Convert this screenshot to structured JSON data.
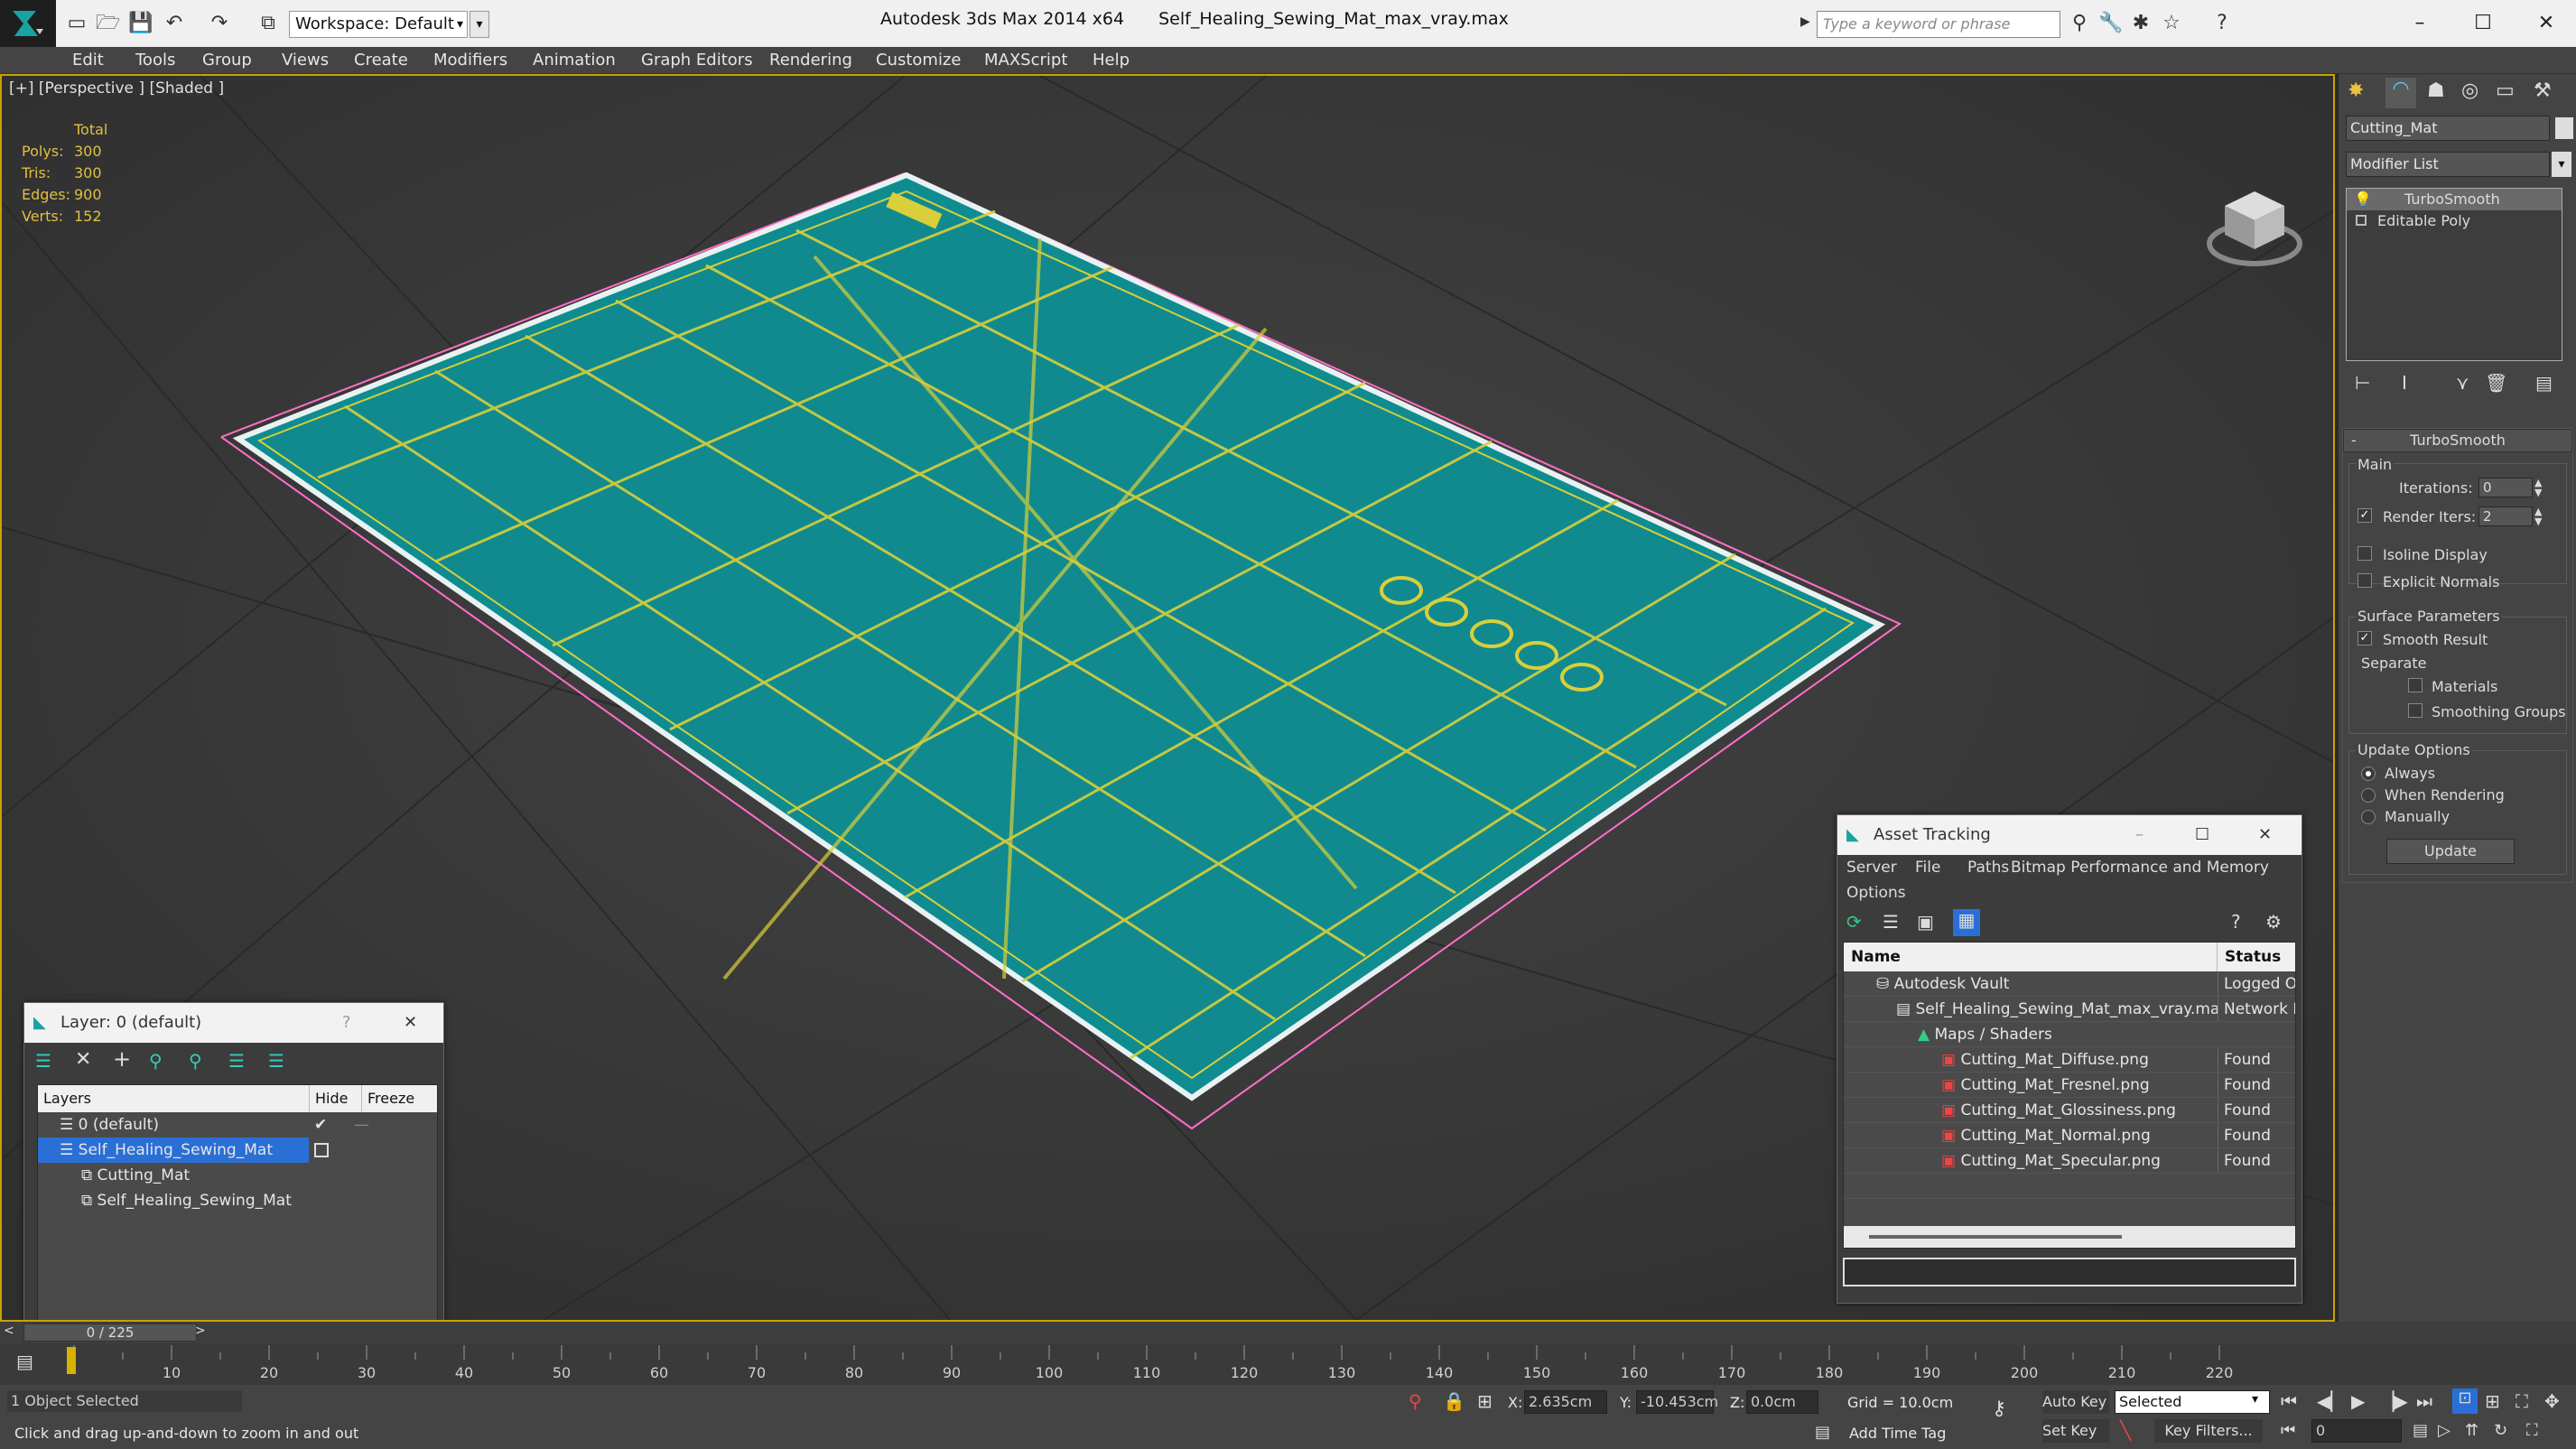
{
  "titlebar": {
    "workspace": "Workspace: Default",
    "app_name": "Autodesk 3ds Max  2014 x64",
    "file_name": "Self_Healing_Sewing_Mat_max_vray.max",
    "search_placeholder": "Type a keyword or phrase"
  },
  "menu": [
    "Edit",
    "Tools",
    "Group",
    "Views",
    "Create",
    "Modifiers",
    "Animation",
    "Graph Editors",
    "Rendering",
    "Customize",
    "MAXScript",
    "Help"
  ],
  "viewport": {
    "label": "[+] [Perspective ] [Shaded ]",
    "stats": {
      "header": "Total",
      "rows": [
        {
          "label": "Polys:",
          "value": "300"
        },
        {
          "label": "Tris:",
          "value": "300"
        },
        {
          "label": "Edges:",
          "value": "900"
        },
        {
          "label": "Verts:",
          "value": "152"
        }
      ]
    },
    "colors": {
      "mat": "#0e8f92",
      "grid": "#d8cf3a",
      "selection": "#ff6fc8",
      "background": "#3a3a3a"
    }
  },
  "command_panel": {
    "object_name": "Cutting_Mat",
    "modifier_list": "Modifier List",
    "stack": [
      "TurboSmooth",
      "Editable Poly"
    ],
    "turbosmooth": {
      "title": "TurboSmooth",
      "main": "Main",
      "iterations_label": "Iterations:",
      "iterations": "0",
      "render_iters_label": "Render Iters:",
      "render_iters": "2",
      "isoline": "Isoline Display",
      "explicit_normals": "Explicit Normals",
      "surface_params": "Surface Parameters",
      "smooth_result": "Smooth Result",
      "separate": "Separate",
      "materials": "Materials",
      "smoothing_groups": "Smoothing Groups",
      "update_options": "Update Options",
      "always": "Always",
      "when_rendering": "When Rendering",
      "manually": "Manually",
      "update_button": "Update"
    }
  },
  "layer_dialog": {
    "title": "Layer: 0 (default)",
    "help": "?",
    "columns": [
      "Layers",
      "Hide",
      "Freeze"
    ],
    "rows": [
      {
        "name": "0 (default)",
        "indent": 0
      },
      {
        "name": "Self_Healing_Sewing_Mat",
        "indent": 0
      },
      {
        "name": "Cutting_Mat",
        "indent": 1
      },
      {
        "name": "Self_Healing_Sewing_Mat",
        "indent": 1
      }
    ]
  },
  "asset_tracking": {
    "title": "Asset Tracking",
    "menu": [
      "Server",
      "File",
      "Paths",
      "Bitmap Performance and Memory",
      "Options"
    ],
    "columns": [
      "Name",
      "Status"
    ],
    "rows": [
      {
        "name": "Autodesk Vault",
        "status": "Logged O",
        "indent": 1
      },
      {
        "name": "Self_Healing_Sewing_Mat_max_vray.max",
        "status": "Network F",
        "indent": 2
      },
      {
        "name": "Maps / Shaders",
        "status": "",
        "indent": 3
      },
      {
        "name": "Cutting_Mat_Diffuse.png",
        "status": "Found",
        "indent": 4
      },
      {
        "name": "Cutting_Mat_Fresnel.png",
        "status": "Found",
        "indent": 4
      },
      {
        "name": "Cutting_Mat_Glossiness.png",
        "status": "Found",
        "indent": 4
      },
      {
        "name": "Cutting_Mat_Normal.png",
        "status": "Found",
        "indent": 4
      },
      {
        "name": "Cutting_Mat_Specular.png",
        "status": "Found",
        "indent": 4
      }
    ]
  },
  "timeline": {
    "frame": "0 / 225",
    "ticks": [
      "10",
      "20",
      "30",
      "40",
      "50",
      "60",
      "70",
      "80",
      "90",
      "100",
      "110",
      "120",
      "130",
      "140",
      "150",
      "160",
      "170",
      "180",
      "190",
      "200",
      "210",
      "220"
    ]
  },
  "status": {
    "selected": "1 Object Selected",
    "prompt": "Click and drag up-and-down to zoom in and out",
    "x_label": "X:",
    "x": "2.635cm",
    "y_label": "Y:",
    "y": "-10.453cm",
    "z_label": "Z:",
    "z": "0.0cm",
    "grid": "Grid = 10.0cm",
    "auto_key": "Auto Key",
    "auto_key_mode": "Selected",
    "set_key": "Set Key",
    "key_filters": "Key Filters...",
    "add_time_tag": "Add Time Tag",
    "current_frame": "0"
  }
}
